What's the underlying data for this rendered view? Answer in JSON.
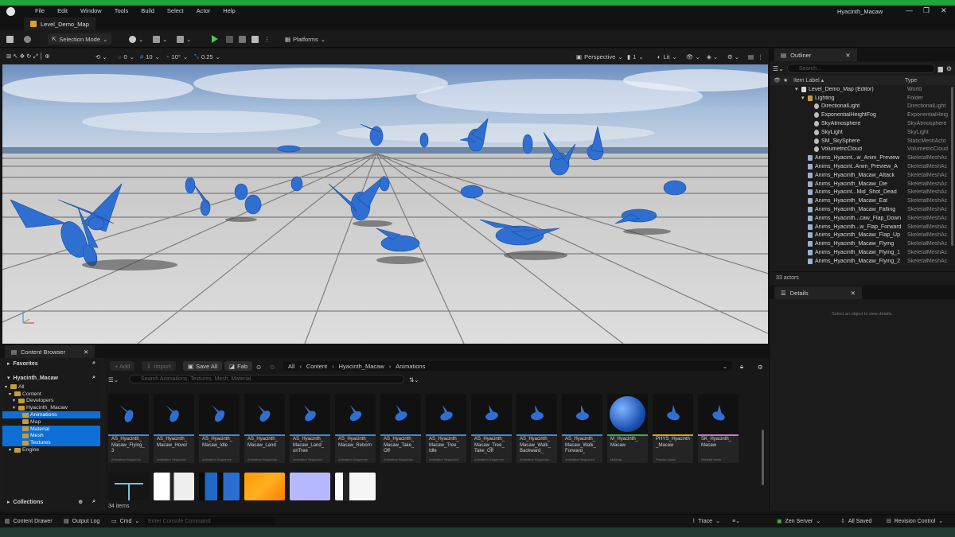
{
  "menubar": {
    "items": [
      "File",
      "Edit",
      "Window",
      "Tools",
      "Build",
      "Select",
      "Actor",
      "Help"
    ],
    "project_title": "Hyacinth_Macaw"
  },
  "tab": {
    "label": "Level_Demo_Map"
  },
  "toolbar": {
    "selection_mode": "Selection Mode",
    "platforms": "Platforms"
  },
  "viewport_toolbar": {
    "angle": "0",
    "grid": "10",
    "rot_snap": "10°",
    "scale_snap": "0.25",
    "perspective": "Perspective",
    "camera_speed": "1",
    "lit": "Lit"
  },
  "outliner": {
    "title": "Outliner",
    "search_placeholder": "Search...",
    "col_label": "Item Label ▴",
    "col_type": "Type",
    "rows": [
      {
        "label": "Level_Demo_Map (Editor)",
        "type": "World",
        "indent": 0,
        "icon": "level"
      },
      {
        "label": "Lighting",
        "type": "Folder",
        "indent": 1,
        "icon": "folder"
      },
      {
        "label": "DirectionalLight",
        "type": "DirectionalLight",
        "indent": 2,
        "icon": "light"
      },
      {
        "label": "ExponentialHeightFog",
        "type": "ExponentialHeig",
        "indent": 2,
        "icon": "light"
      },
      {
        "label": "SkyAtmosphere",
        "type": "SkyAtmosphere",
        "indent": 2,
        "icon": "light"
      },
      {
        "label": "SkyLight",
        "type": "SkyLight",
        "indent": 2,
        "icon": "light"
      },
      {
        "label": "SM_SkySphere",
        "type": "StaticMeshActo",
        "indent": 2,
        "icon": "light"
      },
      {
        "label": "VolumetricCloud",
        "type": "VolumetricCloud",
        "indent": 2,
        "icon": "light"
      },
      {
        "label": "Anims_Hyacint...w_Anim_Preview",
        "type": "SkeletalMeshAc",
        "indent": 1,
        "icon": "mesh"
      },
      {
        "label": "Anims_Hyacint..Anim_Preview_A",
        "type": "SkeletalMeshAc",
        "indent": 1,
        "icon": "mesh"
      },
      {
        "label": "Anims_Hyacinth_Macaw_Attack",
        "type": "SkeletalMeshAc",
        "indent": 1,
        "icon": "mesh"
      },
      {
        "label": "Anims_Hyacinth_Macaw_Die",
        "type": "SkeletalMeshAc",
        "indent": 1,
        "icon": "mesh"
      },
      {
        "label": "Anims_Hyacint...Mid_Shot_Dead",
        "type": "SkeletalMeshAc",
        "indent": 1,
        "icon": "mesh"
      },
      {
        "label": "Anims_Hyacinth_Macaw_Eat",
        "type": "SkeletalMeshAc",
        "indent": 1,
        "icon": "mesh"
      },
      {
        "label": "Anims_Hyacinth_Macaw_Falling",
        "type": "SkeletalMeshAc",
        "indent": 1,
        "icon": "mesh"
      },
      {
        "label": "Anims_Hyacinth...caw_Flap_Down",
        "type": "SkeletalMeshAc",
        "indent": 1,
        "icon": "mesh"
      },
      {
        "label": "Anims_Hyacinth...w_Flap_Forward",
        "type": "SkeletalMeshAc",
        "indent": 1,
        "icon": "mesh"
      },
      {
        "label": "Anims_Hyacinth_Macaw_Flap_Up",
        "type": "SkeletalMeshAc",
        "indent": 1,
        "icon": "mesh"
      },
      {
        "label": "Anims_Hyacinth_Macaw_Flying",
        "type": "SkeletalMeshAc",
        "indent": 1,
        "icon": "mesh"
      },
      {
        "label": "Anims_Hyacinth_Macaw_Flying_1",
        "type": "SkeletalMeshAc",
        "indent": 1,
        "icon": "mesh"
      },
      {
        "label": "Anims_Hyacinth_Macaw_Flying_2",
        "type": "SkeletalMeshAc",
        "indent": 1,
        "icon": "mesh"
      }
    ],
    "count": "33 actors"
  },
  "details": {
    "title": "Details",
    "empty_text": "Select an object to view details."
  },
  "content_browser": {
    "title": "Content Browser",
    "add": "+ Add",
    "import": "Import",
    "save_all": "Save All",
    "fab": "Fab",
    "path": [
      "All",
      "Content",
      "Hyacinth_Macaw",
      "Animations"
    ],
    "search_placeholder": "Search Animations, Textures, Mesh, Material",
    "favorites": "Favorites",
    "root": "Hyacinth_Macaw",
    "tree": [
      {
        "label": "All",
        "indent": 0,
        "sel": false
      },
      {
        "label": "Content",
        "indent": 1,
        "sel": false
      },
      {
        "label": "Developers",
        "indent": 2,
        "sel": false
      },
      {
        "label": "Hyacinth_Macaw",
        "indent": 2,
        "sel": false
      },
      {
        "label": "Animations",
        "indent": 3,
        "sel": true
      },
      {
        "label": "Map",
        "indent": 3,
        "sel": false
      },
      {
        "label": "Material",
        "indent": 3,
        "sel": true
      },
      {
        "label": "Mesh",
        "indent": 3,
        "sel": true
      },
      {
        "label": "Textures",
        "indent": 3,
        "sel": true
      },
      {
        "label": "Engine",
        "indent": 1,
        "sel": false
      }
    ],
    "collections": "Collections",
    "item_count": "34 items",
    "assets": [
      {
        "name": "AS_Hyacinth_ Macaw_Flying_ 3",
        "kind": "Animation Sequence",
        "color": "#3a8cd8"
      },
      {
        "name": "AS_Hyacinth_ Macaw_Hover",
        "kind": "Animation Sequence",
        "color": "#3a8cd8"
      },
      {
        "name": "AS_Hyacinth_ Macaw_Idle",
        "kind": "Animation Sequence",
        "color": "#3a8cd8"
      },
      {
        "name": "AS_Hyacinth_ Macaw_Land",
        "kind": "Animation Sequence",
        "color": "#3a8cd8"
      },
      {
        "name": "AS_Hyacinth_ Macaw_Land_ onTree",
        "kind": "Animation Sequence",
        "color": "#3a8cd8"
      },
      {
        "name": "AS_Hyacinth_ Macaw_Reborn",
        "kind": "Animation Sequence",
        "color": "#3a8cd8"
      },
      {
        "name": "AS_Hyacinth_ Macaw_Take_ Off",
        "kind": "Animation Sequence",
        "color": "#3a8cd8"
      },
      {
        "name": "AS_Hyacinth_ Macaw_Tree_ Idle",
        "kind": "Animation Sequence",
        "color": "#3a8cd8"
      },
      {
        "name": "AS_Hyacinth_ Macaw_Tree_ Take_Off",
        "kind": "Animation Sequence",
        "color": "#3a8cd8"
      },
      {
        "name": "AS_Hyacinth_ Macaw_Walk_ Backward_",
        "kind": "Animation Sequence",
        "color": "#3a8cd8"
      },
      {
        "name": "AS_Hyacinth_ Macaw_Walk_ Forward_",
        "kind": "Animation Sequence",
        "color": "#3a8cd8"
      },
      {
        "name": "M_Hyacinth_ Macaw",
        "kind": "Material",
        "color": "#3bb04a"
      },
      {
        "name": "PHYS_Hyacinth _Macaw",
        "kind": "Physics Asset",
        "color": "#d8a030"
      },
      {
        "name": "SK_Hyacinth_ Macaw",
        "kind": "Skeletal Mesh",
        "color": "#c878d8"
      }
    ]
  },
  "statusbar": {
    "content_drawer": "Content Drawer",
    "output_log": "Output Log",
    "cmd": "Cmd",
    "console_placeholder": "Enter Console Command",
    "trace": "Trace",
    "zen": "Zen Server",
    "saved": "All Saved",
    "revision": "Revision Control"
  },
  "colors": {
    "accent_green": "#1fa53a",
    "selection_blue": "#0d6fd6",
    "macaw_blue": "#2f6fd2"
  }
}
